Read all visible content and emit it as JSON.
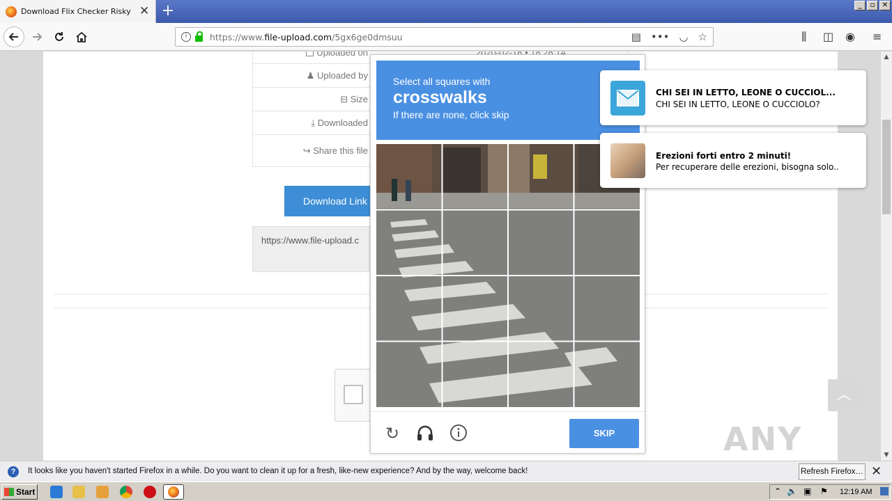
{
  "browser": {
    "tab_title": "Download Flix Checker Risky rar",
    "tab_close": "✕",
    "new_tab": "+",
    "url_prefix": "https://www.",
    "url_domain": "file-upload.com",
    "url_path": "/5gx6ge0dmsuu",
    "window_buttons": [
      "_",
      "▫",
      "✕"
    ]
  },
  "page": {
    "rows": [
      {
        "label": "Uploaded on",
        "icon": "calendar-icon",
        "value": "2020-02-18 • 18:28:14"
      },
      {
        "label": "Uploaded by",
        "icon": "user-icon",
        "value": ""
      },
      {
        "label": "Size",
        "icon": "hdd-icon",
        "value": ""
      },
      {
        "label": "Downloaded",
        "icon": "download-icon",
        "value": ""
      },
      {
        "label": "Share this file",
        "icon": "share-icon",
        "value": ""
      }
    ],
    "download_button": "Download Link",
    "url_box": "https://www.file-upload.c",
    "watermark": "ANY RUN"
  },
  "captcha": {
    "line1": "Select all squares with",
    "keyword": "crosswalks",
    "line3": "If there are none, click skip",
    "skip_label": "SKIP",
    "accent": "#4a90e2"
  },
  "notifications": [
    {
      "title": "CHI SEI IN LETTO, LEONE O CUCCIOL...",
      "body": "CHI SEI IN LETTO, LEONE O CUCCIOLO?",
      "icon": "envelope-icon"
    },
    {
      "title": "Erezioni forti entro 2 minuti!",
      "body": "Per recuperare delle erezioni, bisogna solo..",
      "icon": "photo-icon"
    }
  ],
  "ffbar": {
    "message": "It looks like you haven't started Firefox in a while. Do you want to clean it up for a fresh, like-new experience? And by the way, welcome back!",
    "refresh_label": "Refresh Firefox…",
    "close": "✕"
  },
  "taskbar": {
    "start_label": "Start",
    "time": "12:19 AM"
  }
}
